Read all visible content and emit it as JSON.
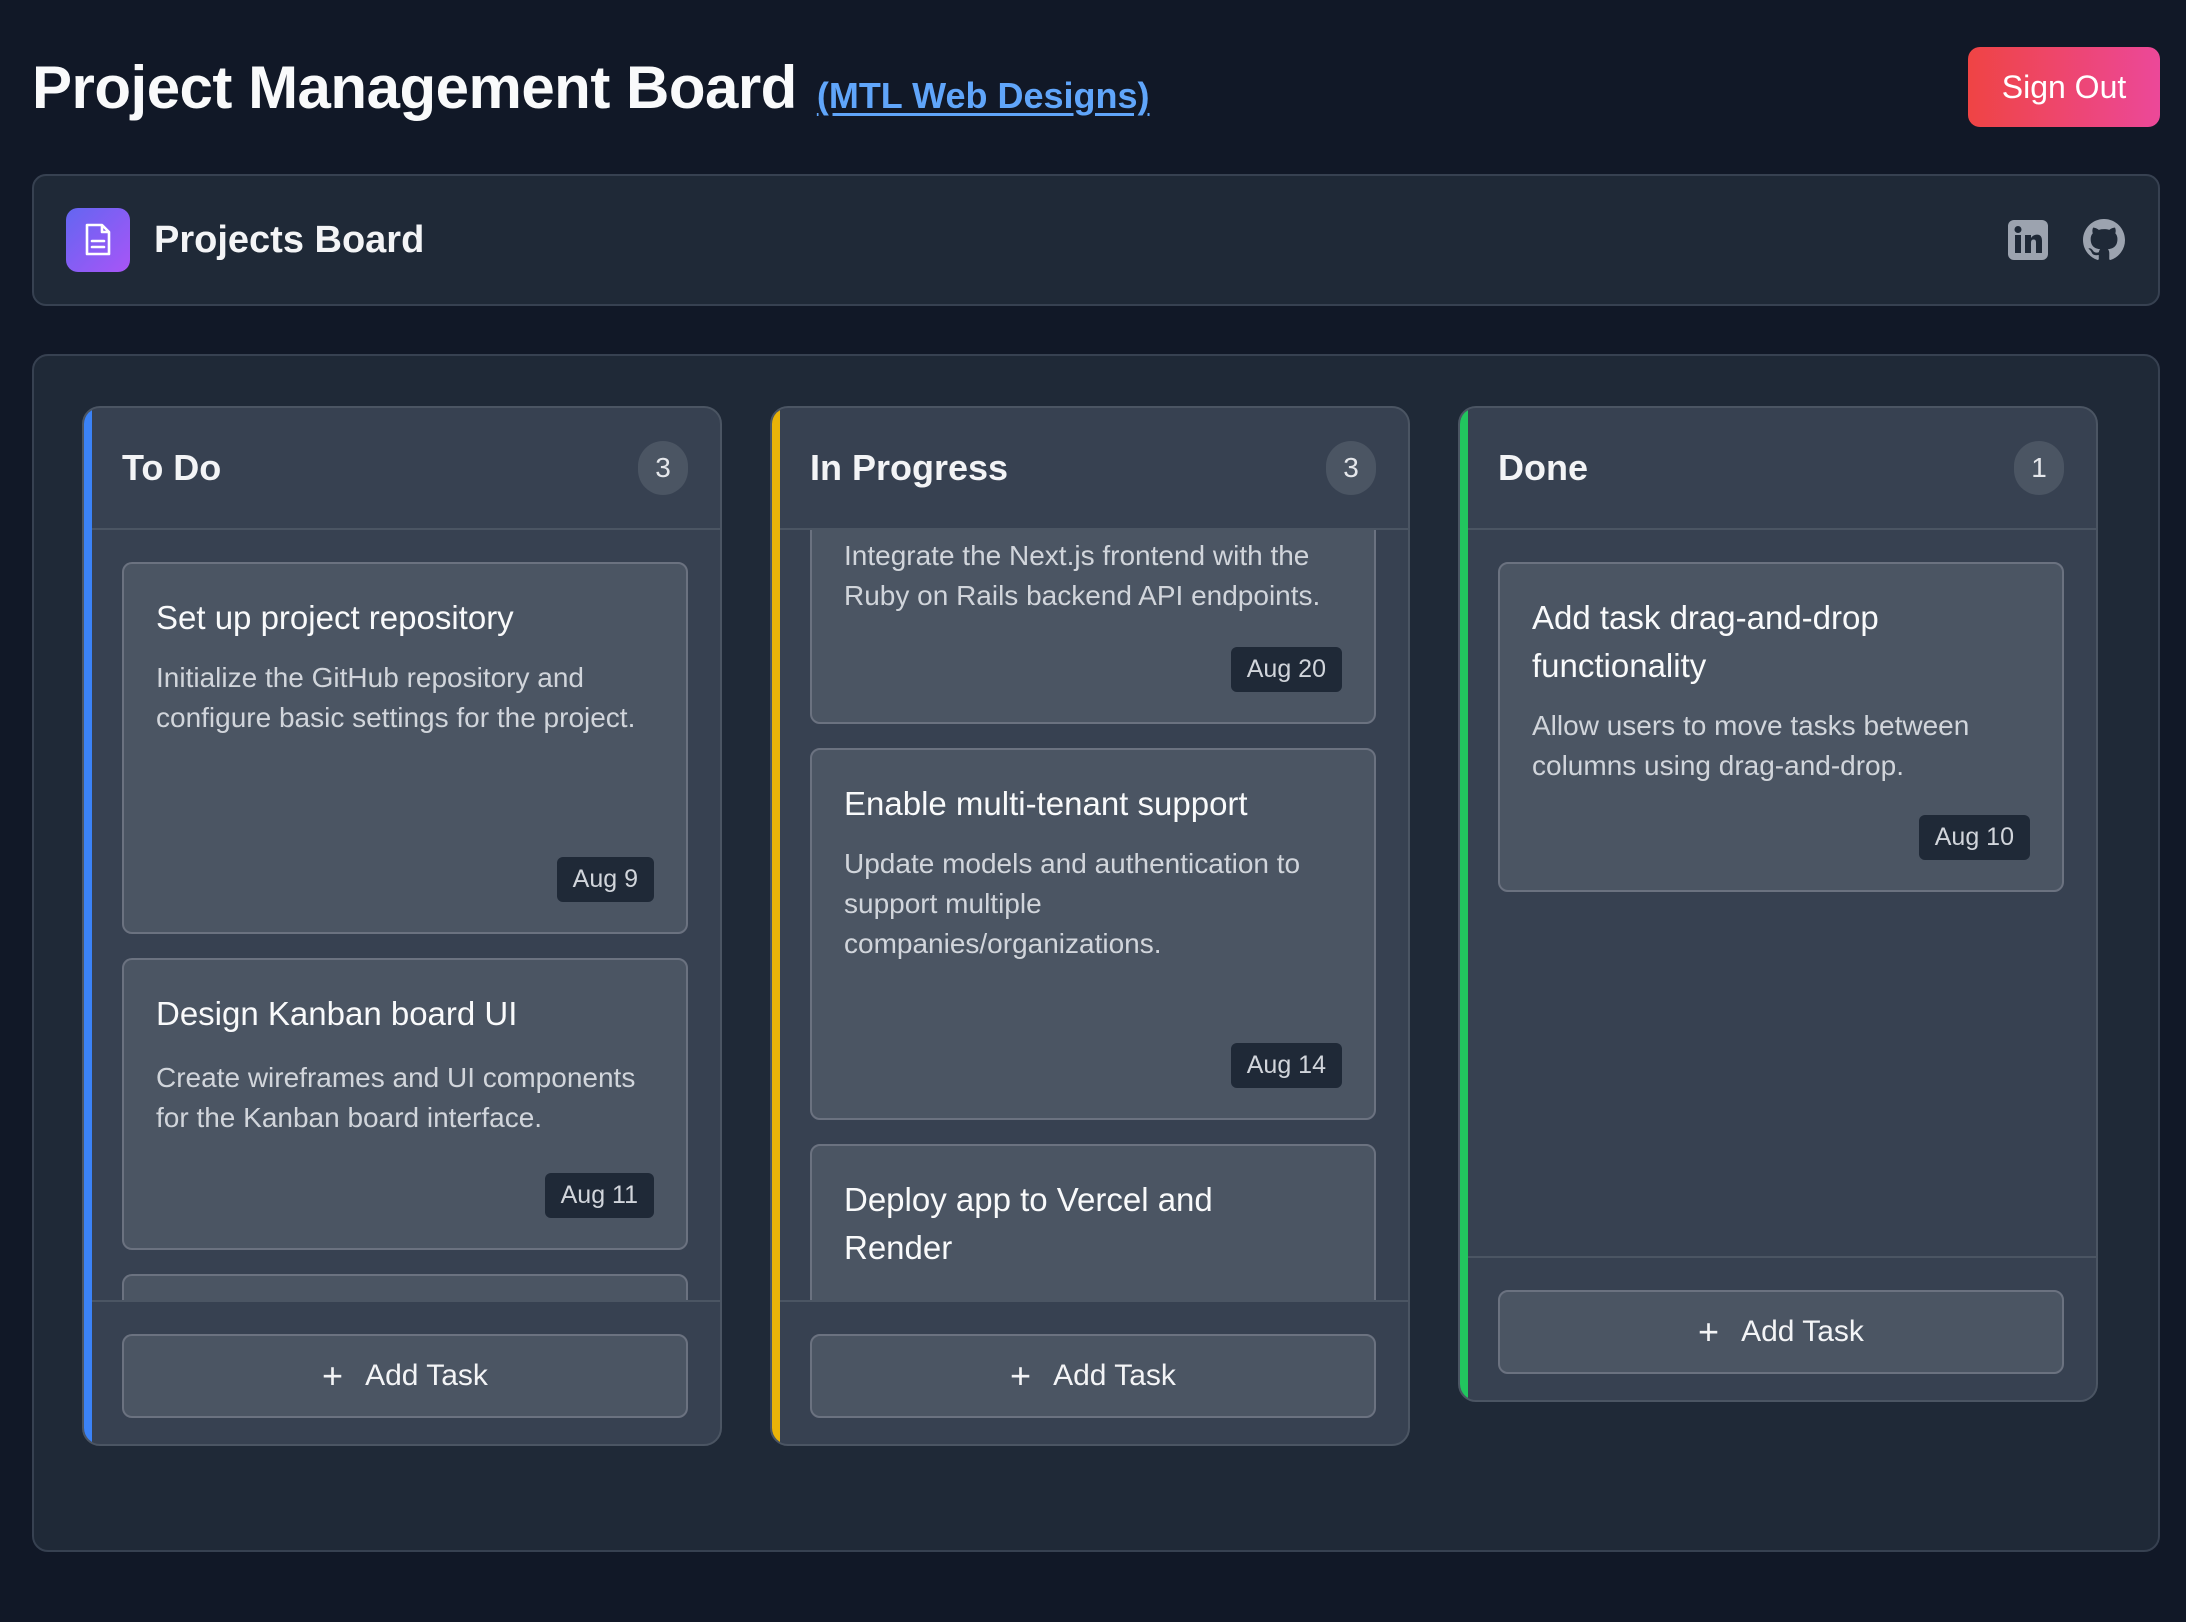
{
  "header": {
    "title": "Project Management Board",
    "company": "(MTL Web Designs)",
    "sign_out": "Sign Out"
  },
  "board": {
    "name": "Projects Board",
    "icon": "document-icon",
    "social": [
      "linkedin-icon",
      "github-icon"
    ]
  },
  "colors": {
    "todo": "#3b82f6",
    "in_progress": "#eab308",
    "done": "#22c55e",
    "sign_out_gradient": [
      "#ef4444",
      "#ec4899"
    ]
  },
  "columns": [
    {
      "title": "To Do",
      "count": "3",
      "tasks": [
        {
          "title": "Set up project repository",
          "description": "Initialize the GitHub repository and configure basic settings for the project.",
          "date": "Aug 9"
        },
        {
          "title": "Design Kanban board UI",
          "description": "Create wireframes and UI components for the Kanban board interface.",
          "date": "Aug 11"
        }
      ],
      "add_label": "Add Task"
    },
    {
      "title": "In Progress",
      "count": "3",
      "tasks": [
        {
          "title": "",
          "description": "Integrate the Next.js frontend with the Ruby on Rails backend API endpoints.",
          "date": "Aug 20"
        },
        {
          "title": "Enable multi-tenant support",
          "description": "Update models and authentication to support multiple companies/organizations.",
          "date": "Aug 14"
        },
        {
          "title": "Deploy app to Vercel and Render",
          "description": "",
          "date": ""
        }
      ],
      "add_label": "Add Task"
    },
    {
      "title": "Done",
      "count": "1",
      "tasks": [
        {
          "title": "Add task drag-and-drop functionality",
          "description": "Allow users to move tasks between columns using drag-and-drop.",
          "date": "Aug 10"
        }
      ],
      "add_label": "Add Task"
    }
  ]
}
